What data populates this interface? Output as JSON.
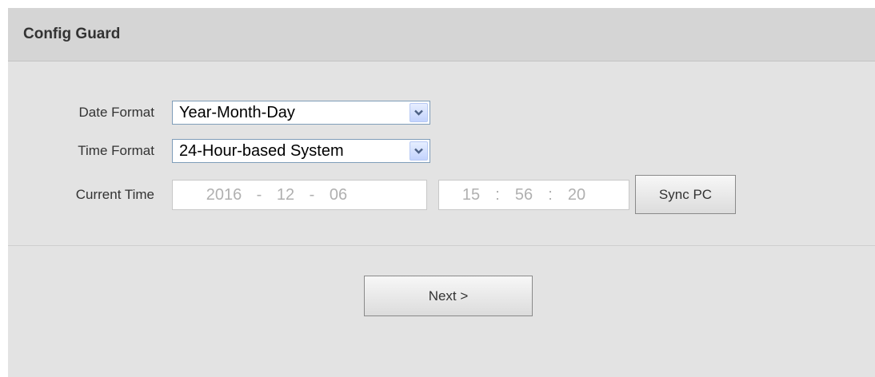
{
  "header": {
    "title": "Config Guard"
  },
  "form": {
    "date_format": {
      "label": "Date Format",
      "value": "Year-Month-Day"
    },
    "time_format": {
      "label": "Time Format",
      "value": "24-Hour-based System"
    },
    "current_time": {
      "label": "Current Time",
      "date": {
        "year": "2016",
        "month": "12",
        "day": "06",
        "separator": "-"
      },
      "time": {
        "hour": "15",
        "minute": "56",
        "second": "20",
        "separator": ":"
      },
      "sync_button": "Sync PC"
    }
  },
  "footer": {
    "next_button": "Next >"
  },
  "colors": {
    "panel_bg": "#e3e3e3",
    "header_bg": "#d5d5d5",
    "select_border": "#7f9db9",
    "arrow_blue": "#4d6185",
    "time_text": "#b0b0b0"
  },
  "icons": {
    "dropdown_arrow": "chevron-down-icon"
  }
}
